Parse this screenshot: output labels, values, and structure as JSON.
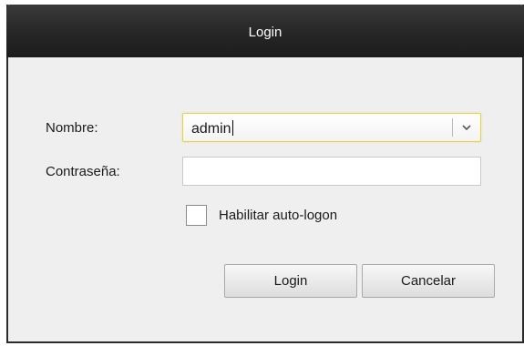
{
  "window": {
    "title": "Login"
  },
  "form": {
    "username_label": "Nombre:",
    "username_value": "admin",
    "password_label": "Contraseña:",
    "password_value": "",
    "autologon_label": "Habilitar auto-logon",
    "autologon_checked": false
  },
  "buttons": {
    "login_label": "Login",
    "cancel_label": "Cancelar"
  },
  "icons": {
    "combo_arrow": "chevron-down-icon"
  },
  "colors": {
    "titlebar": "#262626",
    "dialog_background": "#efefef",
    "focus_border": "#e6cf52"
  }
}
